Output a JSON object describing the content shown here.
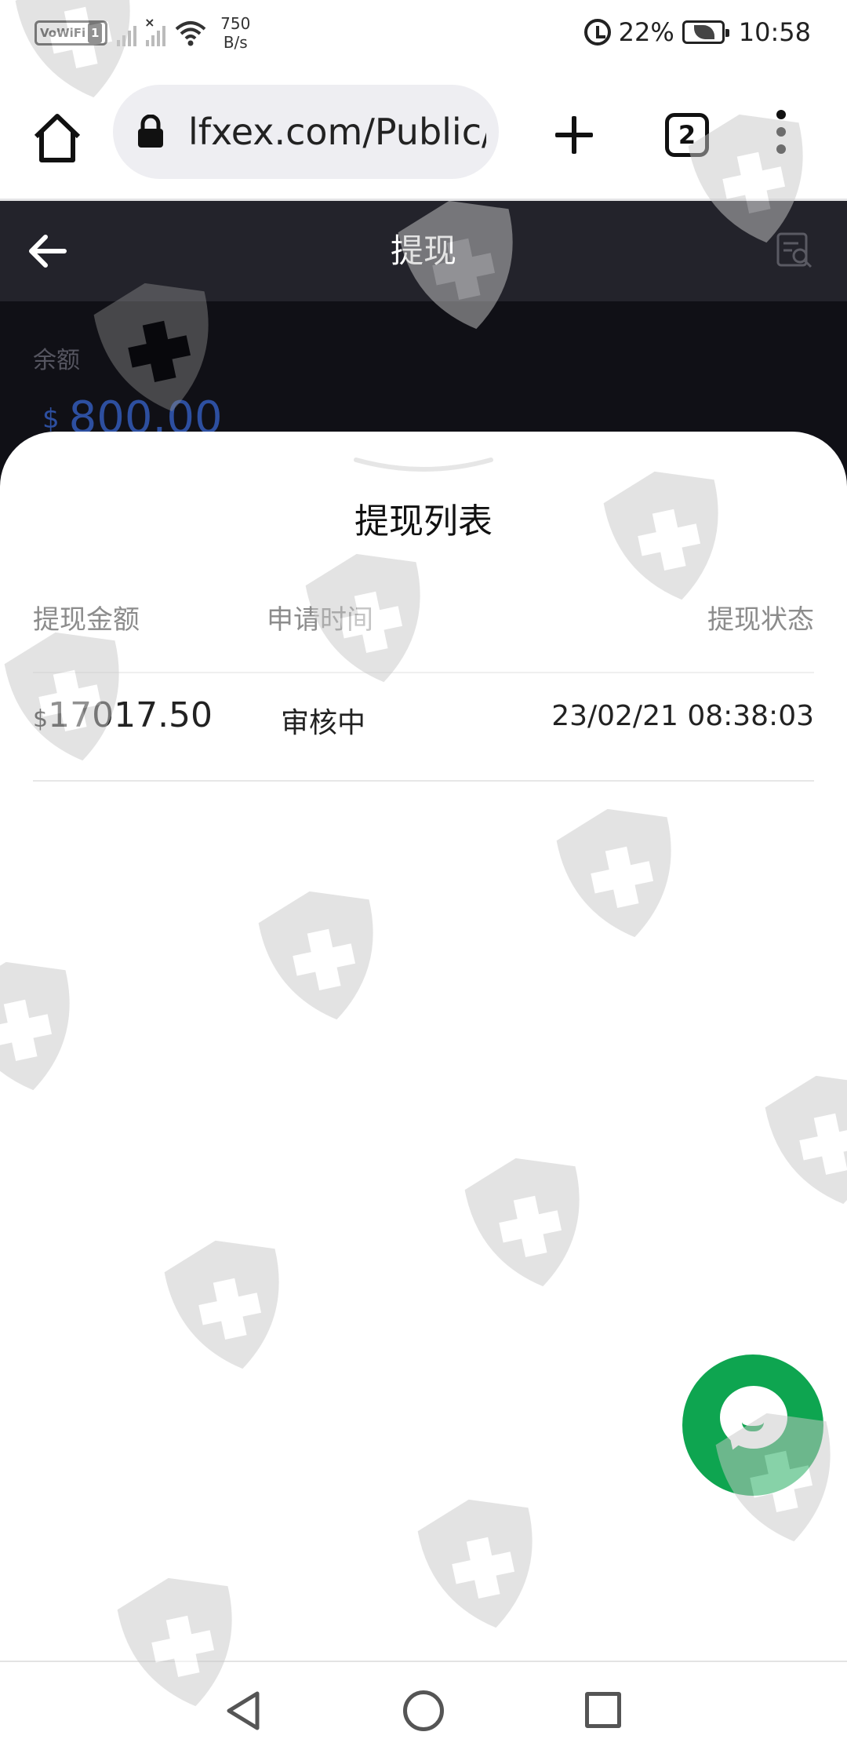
{
  "status_bar": {
    "vowifi": "VoWiFi",
    "sim": "1",
    "net_speed_value": "750",
    "net_speed_unit": "B/s",
    "battery": "22%",
    "time": "10:58"
  },
  "browser": {
    "url": "lfxex.com/Public/",
    "tab_count": "2"
  },
  "header": {
    "title": "提现"
  },
  "balance": {
    "label": "余额",
    "currency": "$",
    "value": "800.00"
  },
  "sheet": {
    "title": "提现列表",
    "columns": [
      "提现金额",
      "申请时间",
      "提现状态"
    ],
    "rows": [
      {
        "currency": "$",
        "amount": "17017.50",
        "status": "审核中",
        "datetime": "23/02/21 08:38:03"
      }
    ]
  },
  "colors": {
    "header_bg": "#23232b",
    "balance_bg": "#101016",
    "balance_value": "#2d4fa0",
    "chat_fab": "#0ea550"
  },
  "icons": [
    "home-icon",
    "lock-icon",
    "plus-icon",
    "tabs-icon",
    "more-vert-icon",
    "back-arrow-icon",
    "record-search-icon",
    "chevron-down-icon",
    "chat-icon",
    "nav-back-icon",
    "nav-home-icon",
    "nav-recent-icon",
    "watermark-shield-icon"
  ]
}
